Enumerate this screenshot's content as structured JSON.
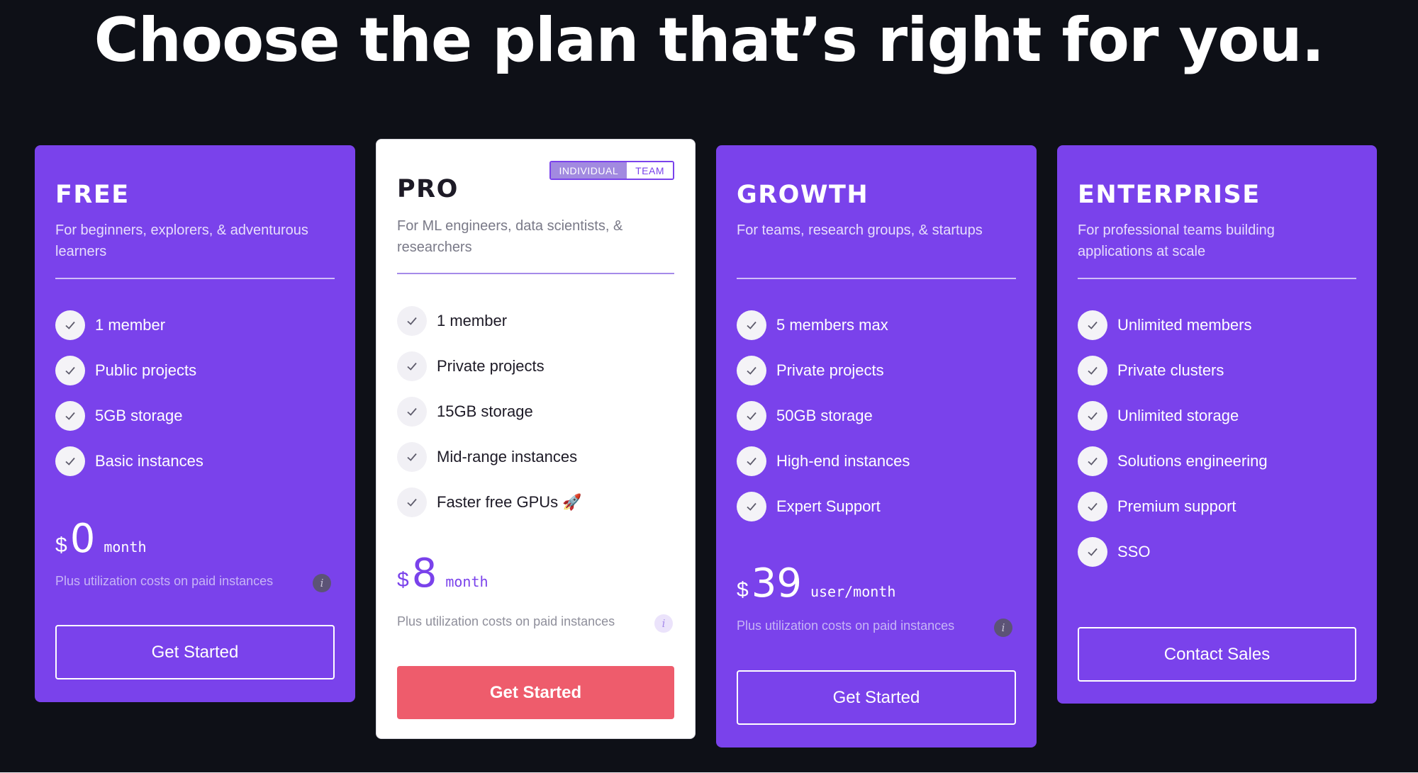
{
  "headline": "Choose the plan that’s right for you.",
  "plans": [
    {
      "name": "FREE",
      "description": "For beginners, explorers, & adventurous learners",
      "features": [
        "1 member",
        "Public projects",
        "5GB storage",
        "Basic instances"
      ],
      "currency": "$",
      "price": "0",
      "period": "month",
      "note": "Plus utilization costs on paid instances",
      "cta": "Get Started"
    },
    {
      "name": "PRO",
      "description": "For ML engineers, data scientists, & researchers",
      "toggle": {
        "individual": "INDIVIDUAL",
        "team": "TEAM",
        "selected": "INDIVIDUAL"
      },
      "features": [
        "1 member",
        "Private projects",
        "15GB storage",
        "Mid-range instances",
        "Faster free GPUs 🚀"
      ],
      "currency": "$",
      "price": "8",
      "period": "month",
      "note": "Plus utilization costs on paid instances",
      "cta": "Get Started"
    },
    {
      "name": "GROWTH",
      "description": "For teams, research groups, & startups",
      "features": [
        "5 members max",
        "Private projects",
        "50GB storage",
        "High-end instances",
        "Expert Support"
      ],
      "currency": "$",
      "price": "39",
      "period": "user/month",
      "note": "Plus utilization costs on paid instances",
      "cta": "Get Started"
    },
    {
      "name": "ENTERPRISE",
      "description": "For professional teams building applications at scale",
      "features": [
        "Unlimited members",
        "Private clusters",
        "Unlimited storage",
        "Solutions engineering",
        "Premium support",
        "SSO"
      ],
      "cta": "Contact Sales"
    }
  ],
  "icons": {
    "check": "check-icon",
    "info": "info-icon",
    "info_glyph": "i"
  },
  "colors": {
    "background": "#0e1017",
    "card_purple": "#7a42eb",
    "cta_primary": "#ee5c6c",
    "pro_card": "#ffffff"
  }
}
